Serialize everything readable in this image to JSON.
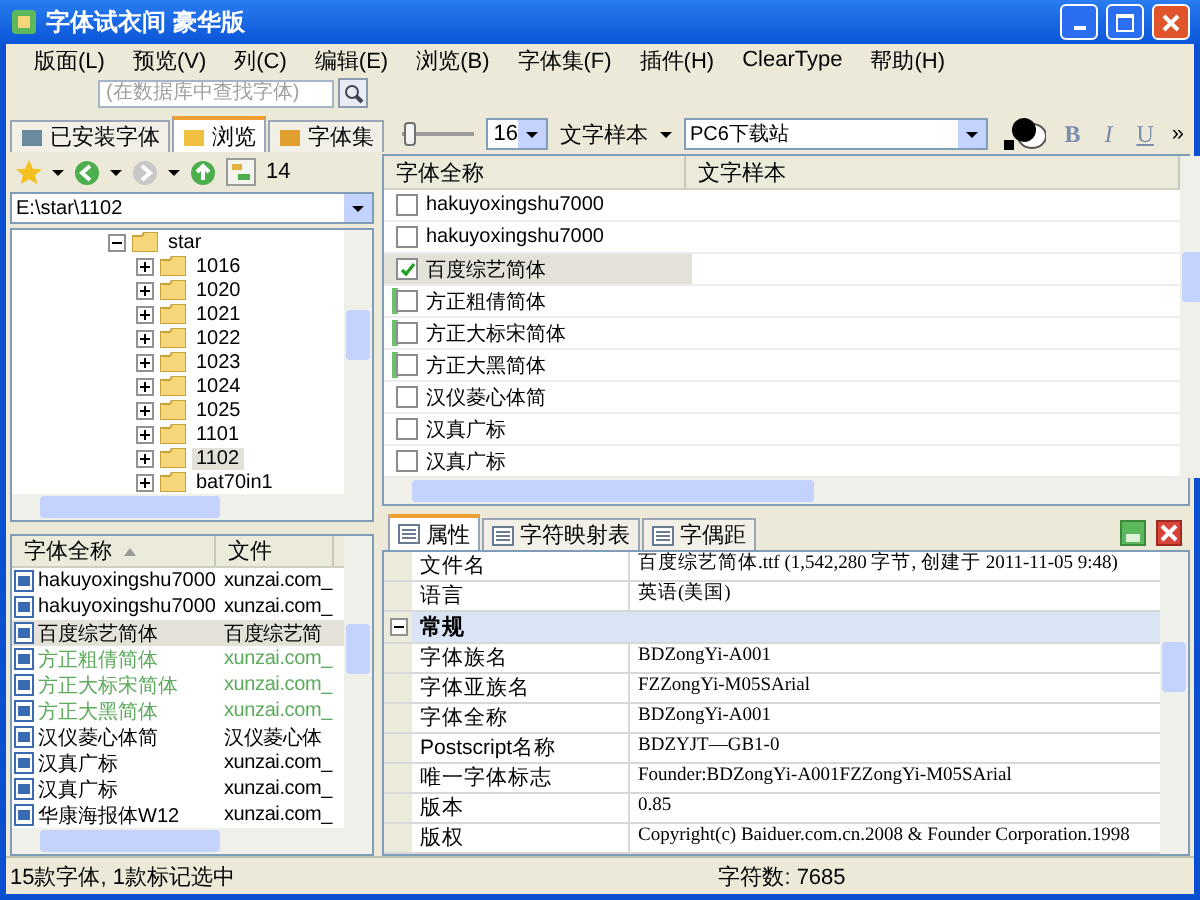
{
  "window": {
    "title": "字体试衣间 豪华版"
  },
  "menu": [
    "版面(L)",
    "预览(V)",
    "列(C)",
    "编辑(E)",
    "浏览(B)",
    "字体集(F)",
    "插件(H)",
    "ClearType",
    "帮助(H)"
  ],
  "search": {
    "placeholder": "(在数据库中查找字体)"
  },
  "left_tabs": [
    {
      "label": "已安装字体",
      "selected": false
    },
    {
      "label": "浏览",
      "selected": true
    },
    {
      "label": "字体集",
      "selected": false
    }
  ],
  "browse_toolbar": {
    "count": "14"
  },
  "path": {
    "value": "E:\\star\\1102"
  },
  "folder_tree": [
    {
      "label": "star",
      "expanded": true,
      "selected": false,
      "children": [
        {
          "label": "1016",
          "expanded": false,
          "selected": false
        },
        {
          "label": "1020",
          "expanded": false,
          "selected": false
        },
        {
          "label": "1021",
          "expanded": false,
          "selected": false
        },
        {
          "label": "1022",
          "expanded": false,
          "selected": false
        },
        {
          "label": "1023",
          "expanded": false,
          "selected": false
        },
        {
          "label": "1024",
          "expanded": false,
          "selected": false
        },
        {
          "label": "1025",
          "expanded": false,
          "selected": false
        },
        {
          "label": "1101",
          "expanded": false,
          "selected": false
        },
        {
          "label": "1102",
          "expanded": false,
          "selected": true
        },
        {
          "label": "bat70in1",
          "expanded": false,
          "selected": false
        }
      ]
    }
  ],
  "font_list": {
    "columns": [
      {
        "label": "字体全称",
        "sorted": true
      },
      {
        "label": "文件",
        "sorted": false
      }
    ],
    "rows": [
      {
        "name": "hakuyoxingshu7000",
        "file": "xunzai.com_",
        "color": "#000000",
        "selected": false
      },
      {
        "name": "hakuyoxingshu7000",
        "file": "xunzai.com_",
        "color": "#000000",
        "selected": false
      },
      {
        "name": "百度综艺简体",
        "file": "百度综艺简",
        "color": "#000000",
        "selected": true
      },
      {
        "name": "方正粗倩简体",
        "file": "xunzai.com_",
        "color": "#5caa5c",
        "selected": false
      },
      {
        "name": "方正大标宋简体",
        "file": "xunzai.com_",
        "color": "#5caa5c",
        "selected": false
      },
      {
        "name": "方正大黑简体",
        "file": "xunzai.com_",
        "color": "#5caa5c",
        "selected": false
      },
      {
        "name": "汉仪菱心体简",
        "file": "汉仪菱心体",
        "color": "#000000",
        "selected": false
      },
      {
        "name": "汉真广标",
        "file": "xunzai.com_",
        "color": "#000000",
        "selected": false
      },
      {
        "name": "汉真广标",
        "file": "xunzai.com_",
        "color": "#000000",
        "selected": false
      },
      {
        "name": "华康海报体W12",
        "file": "xunzai.com_",
        "color": "#000000",
        "selected": false
      }
    ]
  },
  "preview_toolbar": {
    "size_slider": {
      "level": 0.1
    },
    "size": "16",
    "sample_mode": "文字样本",
    "sample_text": "PC6下载站",
    "format_buttons": [
      "B",
      "I",
      "U"
    ],
    "overflow": "»"
  },
  "preview_table": {
    "columns": [
      "字体全称",
      "文字样本"
    ],
    "rows": [
      {
        "name": "hakuyoxingshu7000",
        "checked": false,
        "marked": false,
        "selected": false
      },
      {
        "name": "hakuyoxingshu7000",
        "checked": false,
        "marked": false,
        "selected": false
      },
      {
        "name": "百度综艺简体",
        "checked": true,
        "marked": false,
        "selected": true
      },
      {
        "name": "方正粗倩简体",
        "checked": false,
        "marked": true,
        "selected": false
      },
      {
        "name": "方正大标宋简体",
        "checked": false,
        "marked": true,
        "selected": false
      },
      {
        "name": "方正大黑简体",
        "checked": false,
        "marked": true,
        "selected": false
      },
      {
        "name": "汉仪菱心体简",
        "checked": false,
        "marked": false,
        "selected": false
      },
      {
        "name": "汉真广标",
        "checked": false,
        "marked": false,
        "selected": false
      },
      {
        "name": "汉真广标",
        "checked": false,
        "marked": false,
        "selected": false
      }
    ]
  },
  "property_tabs": [
    {
      "label": "属性",
      "selected": true
    },
    {
      "label": "字符映射表",
      "selected": false
    },
    {
      "label": "字偶距",
      "selected": false
    }
  ],
  "properties": [
    {
      "kind": "row",
      "label": "文件名",
      "value": "百度综艺简体.ttf (1,542,280 字节, 创建于 2011-11-05 9:48)"
    },
    {
      "kind": "row",
      "label": "语言",
      "value": "英语(美国)"
    },
    {
      "kind": "group",
      "label": "常规",
      "expanded": true
    },
    {
      "kind": "row",
      "label": "字体族名",
      "value": "BDZongYi-A001"
    },
    {
      "kind": "row",
      "label": "字体亚族名",
      "value": "FZZongYi-M05SArial"
    },
    {
      "kind": "row",
      "label": "字体全称",
      "value": "BDZongYi-A001"
    },
    {
      "kind": "row",
      "label": "Postscript名称",
      "value": "BDZYJT—GB1-0"
    },
    {
      "kind": "row",
      "label": "唯一字体标志",
      "value": "Founder:BDZongYi-A001FZZongYi-M05SArial"
    },
    {
      "kind": "row",
      "label": "版本",
      "value": "0.85"
    },
    {
      "kind": "row",
      "label": "版权",
      "value": "Copyright(c) Baiduer.com.cn.2008 & Founder Corporation.1998"
    }
  ],
  "status_bar": {
    "left": "15款字体, 1款标记选中",
    "right": "字符数: 7685"
  }
}
